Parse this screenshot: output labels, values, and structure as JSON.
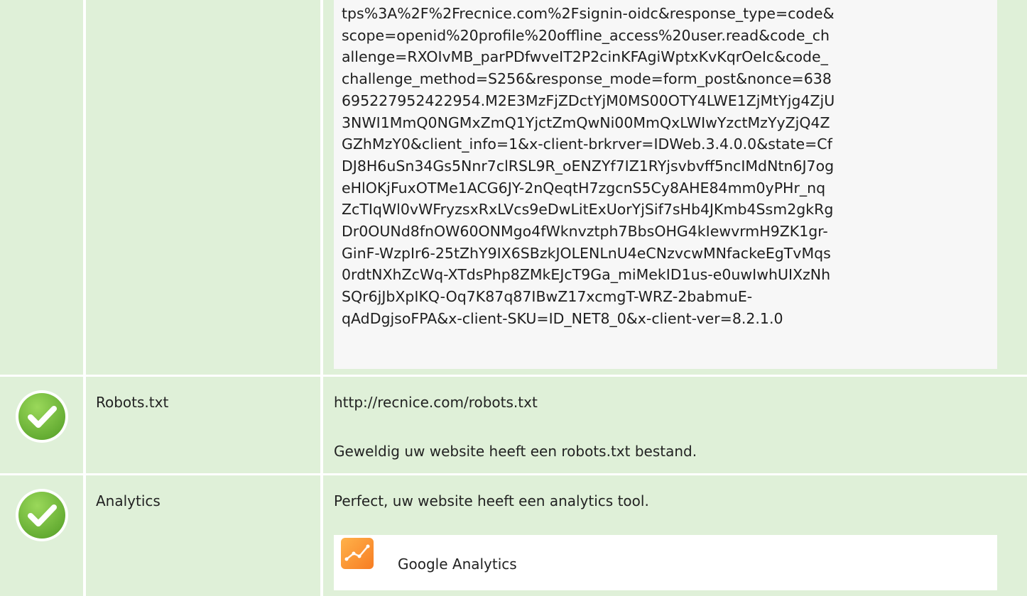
{
  "rows": {
    "first": {
      "code_lines": [
        "tps%3A%2F%2Frecnice.com%2Fsignin-oidc&response_type=code&",
        "scope=openid%20profile%20offline_access%20user.read&code_ch",
        "allenge=RXOIvMB_parPDfwveIT2P2cinKFAgiWptxKvKqrOeIc&code_",
        "challenge_method=S256&response_mode=form_post&nonce=638",
        "695227952422954.M2E3MzFjZDctYjM0MS00OTY4LWE1ZjMtYjg4ZjU",
        "3NWI1MmQ0NGMxZmQ1YjctZmQwNi00MmQxLWIwYzctMzYyZjQ4Z",
        "GZhMzY0&client_info=1&x-client-brkrver=IDWeb.3.4.0.0&state=Cf",
        "DJ8H6uSn34Gs5Nnr7clRSL9R_oENZYf7IZ1RYjsvbvff5ncIMdNtn6J7og",
        "eHlOKjFuxOTMe1ACG6JY-2nQeqtH7zgcnS5Cy8AHE84mm0yPHr_nq",
        "ZcTIqWl0vWFryzsxRxLVcs9eDwLitExUorYjSif7sHb4JKmb4Ssm2gkRg",
        "Dr0OUNd8fnOW60ONMgo4fWknvztph7BbsOHG4kIewvrmH9ZK1gr-",
        "GinF-WzpIr6-25tZhY9IX6SBzkJOLENLnU4eCNzvcwMNfackeEgTvMqs",
        "0rdtNXhZcWq-XTdsPhp8ZMkEJcT9Ga_miMekID1us-e0uwIwhUIXzNh",
        "SQr6jJbXpIKQ-Oq7K87q87IBwZ17xcmgT-WRZ-2babmuE-",
        "qAdDgjsoFPA&x-client-SKU=ID_NET8_0&x-client-ver=8.2.1.0"
      ]
    },
    "robots": {
      "label": "Robots.txt",
      "url": "http://recnice.com/robots.txt",
      "message": "Geweldig uw website heeft een robots.txt bestand."
    },
    "analytics": {
      "label": "Analytics",
      "message": "Perfect, uw website heeft een analytics tool.",
      "tool_name": "Google Analytics"
    }
  },
  "colors": {
    "row_bg": "#dff0d8",
    "check_green": "#7cc242",
    "code_bg": "#f7f7f7"
  },
  "icons": {
    "status": "check-circle-icon",
    "tool": "google-analytics-icon"
  }
}
